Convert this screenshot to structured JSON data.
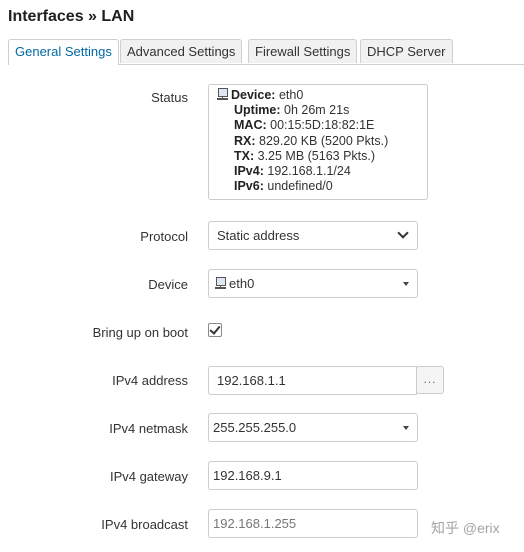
{
  "page": {
    "title": "Interfaces » LAN",
    "tabs": [
      {
        "label": "General Settings",
        "active": true
      },
      {
        "label": "Advanced Settings",
        "active": false
      },
      {
        "label": "Firewall Settings",
        "active": false
      },
      {
        "label": "DHCP Server",
        "active": false
      }
    ]
  },
  "status": {
    "label": "Status",
    "rows": [
      {
        "key": "Device:",
        "value": " eth0"
      },
      {
        "key": "Uptime:",
        "value": " 0h 26m 21s"
      },
      {
        "key": "MAC:",
        "value": " 00:15:5D:18:82:1E"
      },
      {
        "key": "RX:",
        "value": " 829.20 KB (5200 Pkts.)"
      },
      {
        "key": "TX:",
        "value": " 3.25 MB (5163 Pkts.)"
      },
      {
        "key": "IPv4:",
        "value": " 192.168.1.1/24"
      },
      {
        "key": "IPv6:",
        "value": " undefined/0"
      }
    ]
  },
  "form": {
    "protocol": {
      "label": "Protocol",
      "value": "Static address"
    },
    "device": {
      "label": "Device",
      "value": "eth0"
    },
    "bring_up": {
      "label": "Bring up on boot",
      "checked": true
    },
    "ipv4_address": {
      "label": "IPv4 address",
      "value": "192.168.1.1",
      "more": "..."
    },
    "ipv4_netmask": {
      "label": "IPv4 netmask",
      "value": "255.255.255.0"
    },
    "ipv4_gateway": {
      "label": "IPv4 gateway",
      "value": "192.168.9.1"
    },
    "ipv4_broadcast": {
      "label": "IPv4 broadcast",
      "value": "192.168.1.255"
    }
  },
  "watermark": "知乎 @erix",
  "icons": {
    "network": "network-computer-icon"
  }
}
